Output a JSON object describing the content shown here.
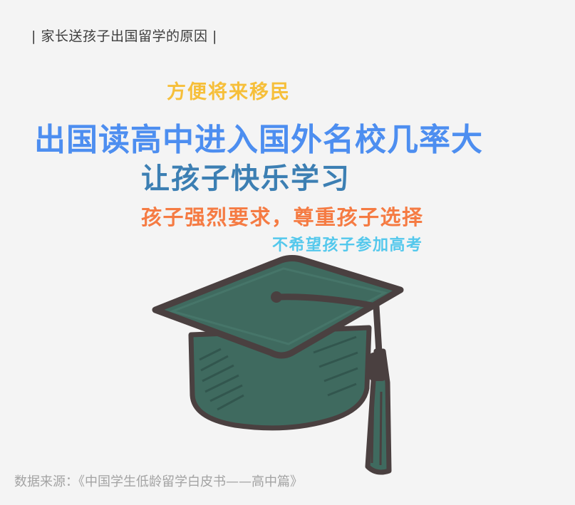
{
  "title": "| 家长送孩子出国留学的原因 |",
  "reasons": [
    {
      "text": "方便将来移民",
      "color": "#f6bf3a"
    },
    {
      "text": "出国读高中进入国外名校几率大",
      "color": "#4d8ef0"
    },
    {
      "text": "让孩子快乐学习",
      "color": "#3c7fb3"
    },
    {
      "text": "孩子强烈要求，尊重孩子选择",
      "color": "#f57b43"
    },
    {
      "text": "不希望孩子参加高考",
      "color": "#54c8ec"
    }
  ],
  "illustration": {
    "icon": "graduation-cap-icon",
    "fill_color": "#3f6a5f",
    "outline_color": "#4a4040"
  },
  "source": "数据来源：《中国学生低龄留学白皮书——高中篇》"
}
